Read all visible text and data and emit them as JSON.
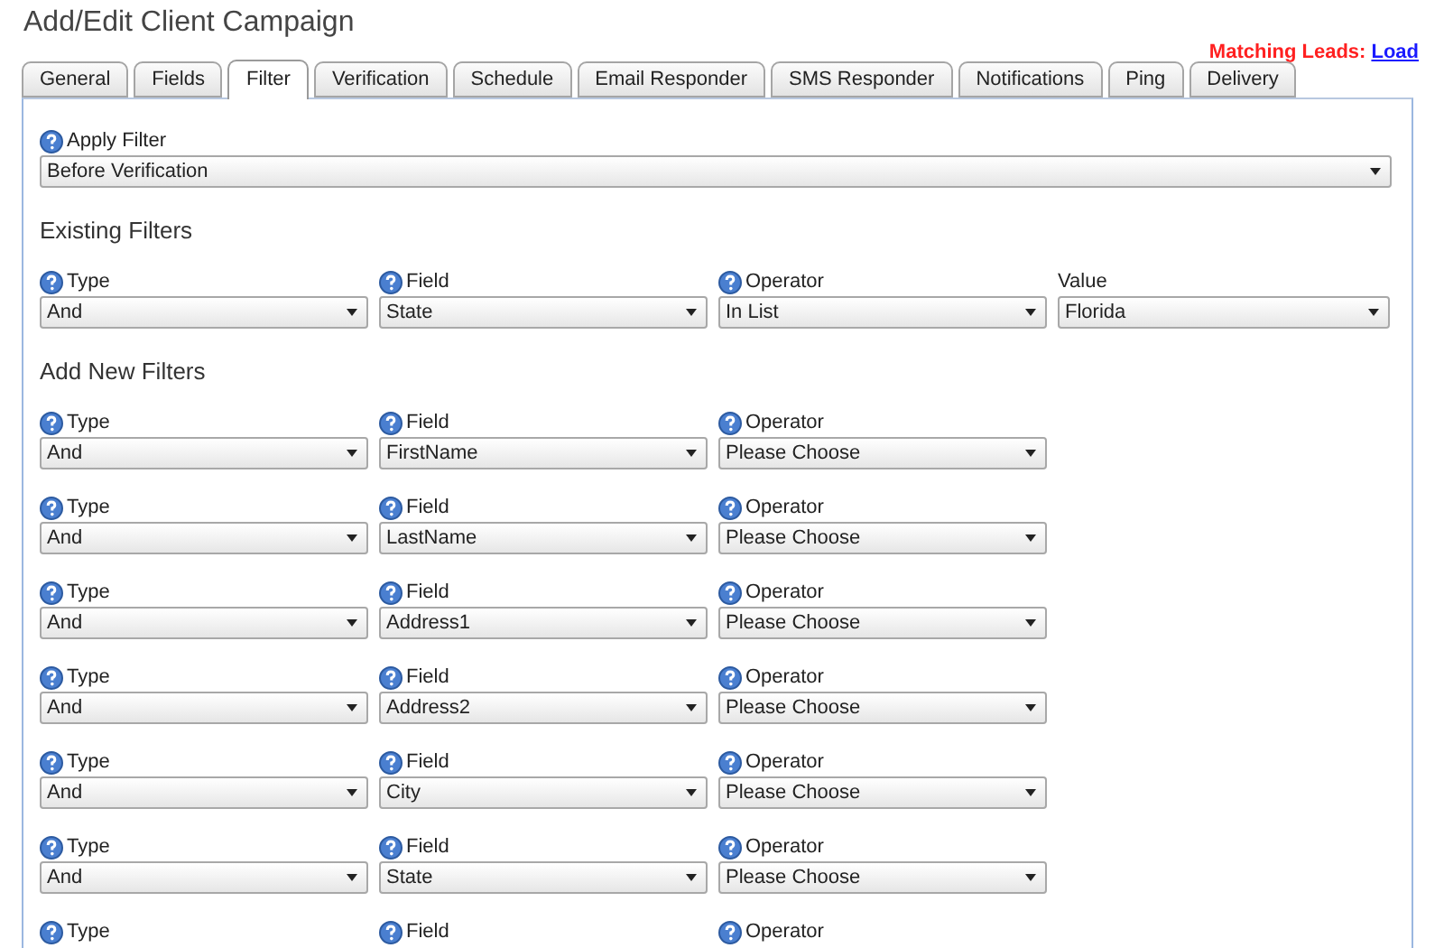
{
  "window": {
    "title": "Add/Edit Client Campaign"
  },
  "matching_leads": {
    "label": "Matching Leads:",
    "link": "Load"
  },
  "tabs": [
    {
      "label": "General",
      "selected": false
    },
    {
      "label": "Fields",
      "selected": false
    },
    {
      "label": "Filter",
      "selected": true
    },
    {
      "label": "Verification",
      "selected": false
    },
    {
      "label": "Schedule",
      "selected": false
    },
    {
      "label": "Email Responder",
      "selected": false
    },
    {
      "label": "SMS Responder",
      "selected": false
    },
    {
      "label": "Notifications",
      "selected": false
    },
    {
      "label": "Ping",
      "selected": false
    },
    {
      "label": "Delivery",
      "selected": false
    }
  ],
  "apply_filter": {
    "label": "Apply Filter",
    "value": "Before Verification"
  },
  "existing_filters": {
    "heading": "Existing Filters",
    "rows": [
      {
        "fields": [
          {
            "label": "Type",
            "help": true,
            "value": "And"
          },
          {
            "label": "Field",
            "help": true,
            "value": "State"
          },
          {
            "label": "Operator",
            "help": true,
            "value": "In List"
          },
          {
            "label": "Value",
            "help": false,
            "value": "Florida"
          }
        ]
      }
    ]
  },
  "new_filters": {
    "heading": "Add New Filters",
    "rows": [
      {
        "fields": [
          {
            "label": "Type",
            "help": true,
            "value": "And"
          },
          {
            "label": "Field",
            "help": true,
            "value": "FirstName"
          },
          {
            "label": "Operator",
            "help": true,
            "value": "Please Choose"
          }
        ]
      },
      {
        "fields": [
          {
            "label": "Type",
            "help": true,
            "value": "And"
          },
          {
            "label": "Field",
            "help": true,
            "value": "LastName"
          },
          {
            "label": "Operator",
            "help": true,
            "value": "Please Choose"
          }
        ]
      },
      {
        "fields": [
          {
            "label": "Type",
            "help": true,
            "value": "And"
          },
          {
            "label": "Field",
            "help": true,
            "value": "Address1"
          },
          {
            "label": "Operator",
            "help": true,
            "value": "Please Choose"
          }
        ]
      },
      {
        "fields": [
          {
            "label": "Type",
            "help": true,
            "value": "And"
          },
          {
            "label": "Field",
            "help": true,
            "value": "Address2"
          },
          {
            "label": "Operator",
            "help": true,
            "value": "Please Choose"
          }
        ]
      },
      {
        "fields": [
          {
            "label": "Type",
            "help": true,
            "value": "And"
          },
          {
            "label": "Field",
            "help": true,
            "value": "City"
          },
          {
            "label": "Operator",
            "help": true,
            "value": "Please Choose"
          }
        ]
      },
      {
        "fields": [
          {
            "label": "Type",
            "help": true,
            "value": "And"
          },
          {
            "label": "Field",
            "help": true,
            "value": "State"
          },
          {
            "label": "Operator",
            "help": true,
            "value": "Please Choose"
          }
        ]
      },
      {
        "fields": [
          {
            "label": "Type",
            "help": true
          },
          {
            "label": "Field",
            "help": true
          },
          {
            "label": "Operator",
            "help": true
          }
        ]
      }
    ]
  }
}
